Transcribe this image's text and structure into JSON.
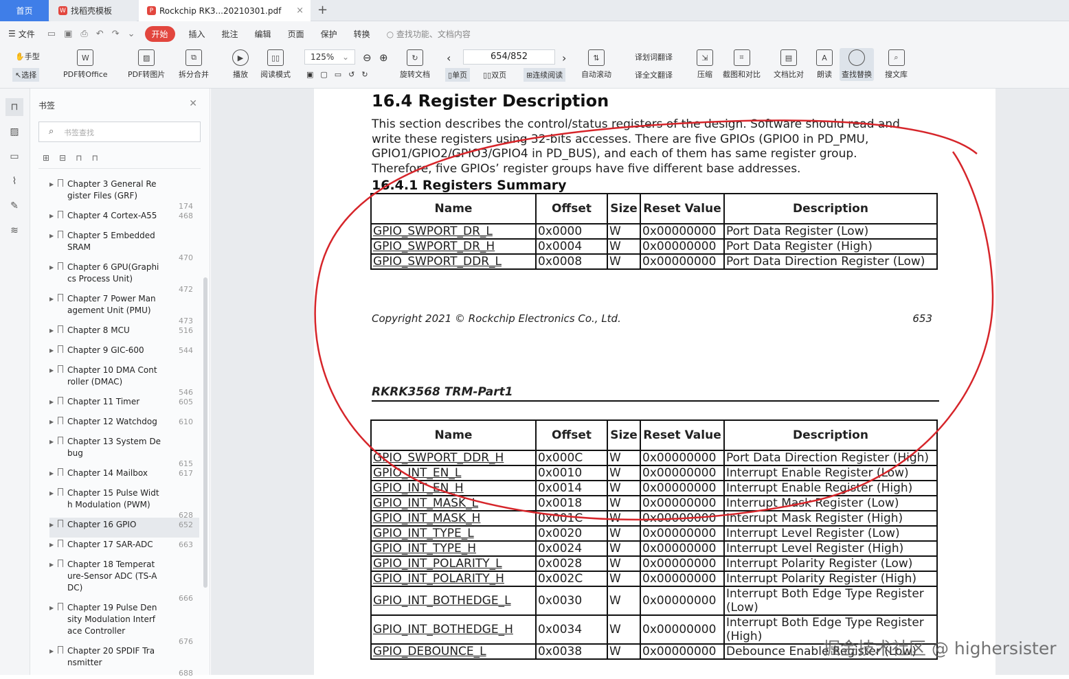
{
  "tabs": {
    "home": "首页",
    "template": "找稻壳模板",
    "pdf": "Rockchip RK3...20210301.pdf"
  },
  "menu": {
    "file": "文件",
    "start": "开始",
    "items": [
      "插入",
      "批注",
      "编辑",
      "页面",
      "保护",
      "转换"
    ],
    "search": "查找功能、文档内容"
  },
  "toolbar": {
    "hand": "手型",
    "select": "选择",
    "pdf_office": "PDF转Office",
    "pdf_image": "PDF转图片",
    "split_merge": "拆分合并",
    "play": "播放",
    "read_mode": "阅读模式",
    "zoom": "125%",
    "page": "654/852",
    "rotate": "旋转文档",
    "single": "单页",
    "double": "双页",
    "continuous": "连续阅读",
    "auto_scroll": "自动滚动",
    "word_translate": "划词翻译",
    "full_translate": "全文翻译",
    "compress": "压缩",
    "screenshot_compare": "截图和对比",
    "doc_compare": "文档比对",
    "read_aloud": "朗读",
    "find_replace": "查找替换",
    "search_library": "搜文库"
  },
  "panel": {
    "title": "书签",
    "search_placeholder": "书签查找",
    "bookmarks": [
      {
        "text": "Chapter 3 General Register Files (GRF)",
        "lines": [
          "Chapter 3 General Re",
          "gister Files (GRF)"
        ],
        "page": "174"
      },
      {
        "text": "Chapter 4 Cortex-A55",
        "lines": [
          "Chapter 4 Cortex-A55"
        ],
        "page": "468"
      },
      {
        "text": "Chapter 5 Embedded SRAM",
        "lines": [
          "Chapter 5 Embedded",
          "SRAM"
        ],
        "page": "470"
      },
      {
        "text": "Chapter 6 GPU",
        "lines": [
          "Chapter 6 GPU(Graphi",
          "cs Process Unit)"
        ],
        "page": "472"
      },
      {
        "text": "Chapter 7 Power Management Unit (PMU)",
        "lines": [
          "Chapter 7 Power Man",
          "agement Unit (PMU)"
        ],
        "page": "473"
      },
      {
        "text": "Chapter 8 MCU",
        "lines": [
          "Chapter 8 MCU"
        ],
        "page": "516"
      },
      {
        "text": "Chapter 9 GIC-600",
        "lines": [
          "Chapter 9 GIC-600"
        ],
        "page": "544"
      },
      {
        "text": "Chapter 10 DMA Controller (DMAC)",
        "lines": [
          "Chapter 10 DMA Cont",
          "roller (DMAC)"
        ],
        "page": "546"
      },
      {
        "text": "Chapter 11 Timer",
        "lines": [
          "Chapter 11 Timer"
        ],
        "page": "605"
      },
      {
        "text": "Chapter 12 Watchdog",
        "lines": [
          "Chapter 12 Watchdog"
        ],
        "page": "610"
      },
      {
        "text": "Chapter 13 System Debug",
        "lines": [
          "Chapter 13 System De",
          "bug"
        ],
        "page": "615"
      },
      {
        "text": "Chapter 14 Mailbox",
        "lines": [
          "Chapter 14 Mailbox"
        ],
        "page": "617"
      },
      {
        "text": "Chapter 15 Pulse Width Modulation (PWM)",
        "lines": [
          "Chapter 15 Pulse Widt",
          "h Modulation (PWM)"
        ],
        "page": "628"
      },
      {
        "text": "Chapter 16 GPIO",
        "lines": [
          "Chapter 16 GPIO"
        ],
        "page": "652",
        "selected": true
      },
      {
        "text": "Chapter 17 SAR-ADC",
        "lines": [
          "Chapter 17 SAR-ADC"
        ],
        "page": "663"
      },
      {
        "text": "Chapter 18 Temperature-Sensor ADC (TS-ADC)",
        "lines": [
          "Chapter 18 Temperat",
          "ure-Sensor ADC (TS-A",
          "DC)"
        ],
        "page": "666"
      },
      {
        "text": "Chapter 19 Pulse Density Modulation Interface Controller",
        "lines": [
          "Chapter 19 Pulse Den",
          "sity Modulation Interf",
          "ace Controller"
        ],
        "page": "676"
      },
      {
        "text": "Chapter 20 SPDIF Transmitter",
        "lines": [
          "Chapter 20 SPDIF Tra",
          "nsmitter"
        ],
        "page": "688"
      }
    ]
  },
  "doc": {
    "heading": "16.4 Register Description",
    "para": [
      "This section describes the control/status registers of the design. Software should read and",
      "write these registers using 32-bits accesses. There are five GPIOs (GPIO0 in PD_PMU,",
      "GPIO1/GPIO2/GPIO3/GPIO4 in PD_BUS), and each of them has same register group.",
      "Therefore, five GPIOs’ register groups have five different base addresses."
    ],
    "subheading": "16.4.1 Registers Summary",
    "headers": [
      "Name",
      "Offset",
      "Size",
      "Reset Value",
      "Description"
    ],
    "rows1": [
      [
        "GPIO_SWPORT_DR_L",
        "0x0000",
        "W",
        "0x00000000",
        "Port Data Register (Low)"
      ],
      [
        "GPIO_SWPORT_DR_H",
        "0x0004",
        "W",
        "0x00000000",
        "Port Data Register (High)"
      ],
      [
        "GPIO_SWPORT_DDR_L",
        "0x0008",
        "W",
        "0x00000000",
        "Port Data Direction Register (Low)"
      ]
    ],
    "copyright": "Copyright 2021 © Rockchip Electronics Co., Ltd.",
    "page_number": "653",
    "header2": "RKRK3568 TRM-Part1",
    "rows2": [
      [
        "GPIO_SWPORT_DDR_H",
        "0x000C",
        "W",
        "0x00000000",
        "Port Data Direction Register (High)"
      ],
      [
        "GPIO_INT_EN_L",
        "0x0010",
        "W",
        "0x00000000",
        "Interrupt Enable Register (Low)"
      ],
      [
        "GPIO_INT_EN_H",
        "0x0014",
        "W",
        "0x00000000",
        "Interrupt Enable Register (High)"
      ],
      [
        "GPIO_INT_MASK_L",
        "0x0018",
        "W",
        "0x00000000",
        "Interrupt Mask Register (Low)"
      ],
      [
        "GPIO_INT_MASK_H",
        "0x001C",
        "W",
        "0x00000000",
        "Interrupt Mask Register (High)"
      ],
      [
        "GPIO_INT_TYPE_L",
        "0x0020",
        "W",
        "0x00000000",
        "Interrupt Level Register (Low)"
      ],
      [
        "GPIO_INT_TYPE_H",
        "0x0024",
        "W",
        "0x00000000",
        "Interrupt Level Register (High)"
      ],
      [
        "GPIO_INT_POLARITY_L",
        "0x0028",
        "W",
        "0x00000000",
        "Interrupt Polarity Register (Low)"
      ],
      [
        "GPIO_INT_POLARITY_H",
        "0x002C",
        "W",
        "0x00000000",
        "Interrupt Polarity Register (High)"
      ],
      [
        "GPIO_INT_BOTHEDGE_L",
        "0x0030",
        "W",
        "0x00000000",
        "Interrupt Both Edge Type Register (Low)"
      ],
      [
        "GPIO_INT_BOTHEDGE_H",
        "0x0034",
        "W",
        "0x00000000",
        "Interrupt Both Edge Type Register (High)"
      ],
      [
        "GPIO_DEBOUNCE_L",
        "0x0038",
        "W",
        "0x00000000",
        "Debounce Enable Register (Low)"
      ]
    ]
  },
  "watermark": "掘金技术社区 @ highersister",
  "colors": {
    "accent": "#3f7ee8",
    "brand": "#e2463e",
    "annotation": "#d6252a"
  }
}
